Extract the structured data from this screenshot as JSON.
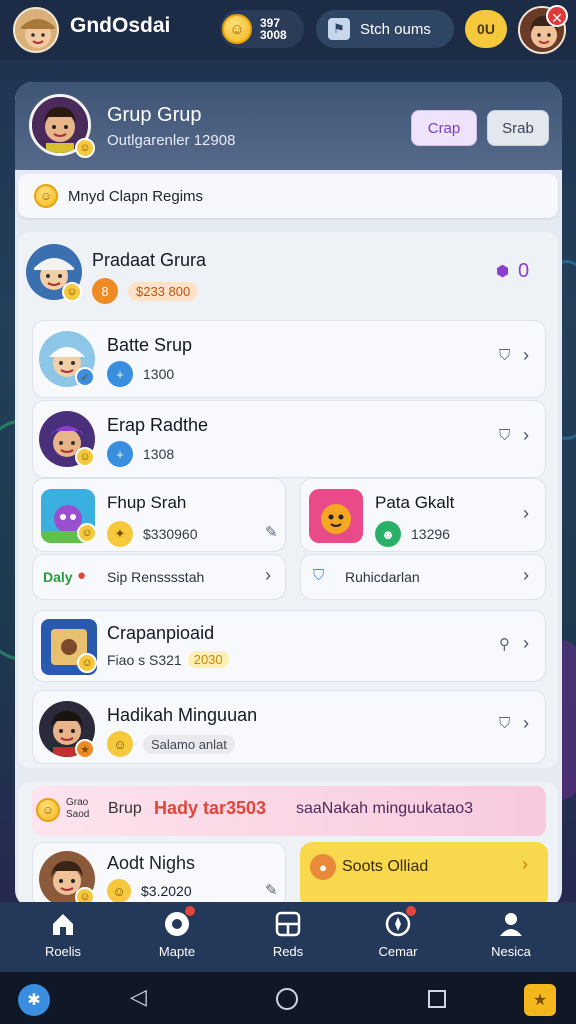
{
  "app": {
    "title": "GndOsdai"
  },
  "top_bar": {
    "coin_text_1": "397",
    "coin_text_2": "3008",
    "status_label": "Stch oums",
    "yellow_label": "0U",
    "close_icon": "close-icon"
  },
  "header": {
    "title": "Grup Grup",
    "subtitle": "Outlgarenler 12908",
    "button_crap": "Crap",
    "button_srab": "Srab"
  },
  "notice": {
    "text": "Mnyd Clapn Regims"
  },
  "rows": [
    {
      "name": "Pradaat Grura",
      "value": "$233 800",
      "right": "0"
    },
    {
      "name": "Batte Srup",
      "value": "1300"
    },
    {
      "name": "Erap Radthe",
      "value": "1308"
    }
  ],
  "half_cards": [
    {
      "name": "Fhup Srah",
      "value": "$330960"
    },
    {
      "name": "Pata Gkalt",
      "value": "13296"
    }
  ],
  "small_rows": [
    {
      "prefix": "Daly",
      "text": "Sip Rensssstah"
    },
    {
      "text": "Ruhicdarlan"
    }
  ],
  "wide_rows": [
    {
      "name": "Crapanpioaid",
      "value": "Fiao s S321",
      "chip": "2030"
    },
    {
      "name": "Hadikah Minguuan",
      "value": "Salamo anlat"
    }
  ],
  "promo": {
    "tiny_1": "Grao",
    "tiny_2": "Saod",
    "text_1": "Brup",
    "text_2": "Hady tar3503",
    "text_3": "saaNakah minguukatao3"
  },
  "bottom_cards": [
    {
      "name": "Aodt Nighs",
      "value": "$3.2020"
    },
    {
      "name": "Soots Olliad"
    }
  ],
  "nav": [
    {
      "label": "Roelis",
      "icon": "home-icon"
    },
    {
      "label": "Mapte",
      "icon": "map-icon"
    },
    {
      "label": "Reds",
      "icon": "grid-icon"
    },
    {
      "label": "Cemar",
      "icon": "compass-icon"
    },
    {
      "label": "Nesica",
      "icon": "profile-icon"
    }
  ]
}
